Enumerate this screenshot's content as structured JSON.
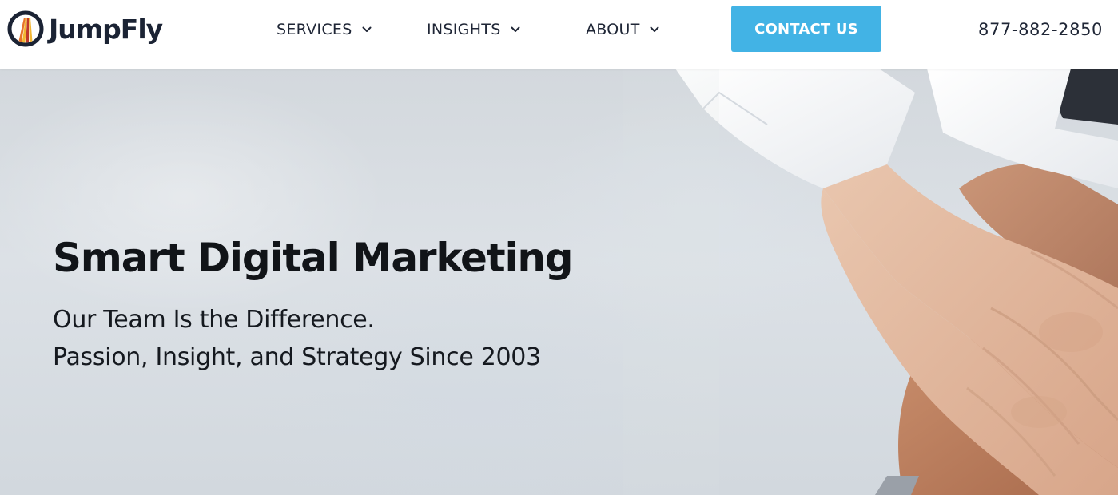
{
  "brand": {
    "name": "JumpFly",
    "colors": {
      "navy": "#1b2334",
      "stripe_orange": "#e8742a",
      "stripe_yellow": "#f2b632",
      "stripe_red": "#c0392b"
    }
  },
  "nav": {
    "items": [
      {
        "label": "SERVICES",
        "icon": "chevron-down-icon"
      },
      {
        "label": "INSIGHTS",
        "icon": "chevron-down-icon"
      },
      {
        "label": "ABOUT",
        "icon": "chevron-down-icon"
      }
    ],
    "contact_label": "CONTACT US",
    "contact_color": "#42b3e5",
    "phone": "877-882-2850"
  },
  "hero": {
    "title": "Smart Digital Marketing",
    "line1": "Our Team Is the Difference.",
    "line2": "Passion, Insight, and Strategy Since 2003",
    "image_subject": "stacked-hands-teamwork-photo"
  }
}
